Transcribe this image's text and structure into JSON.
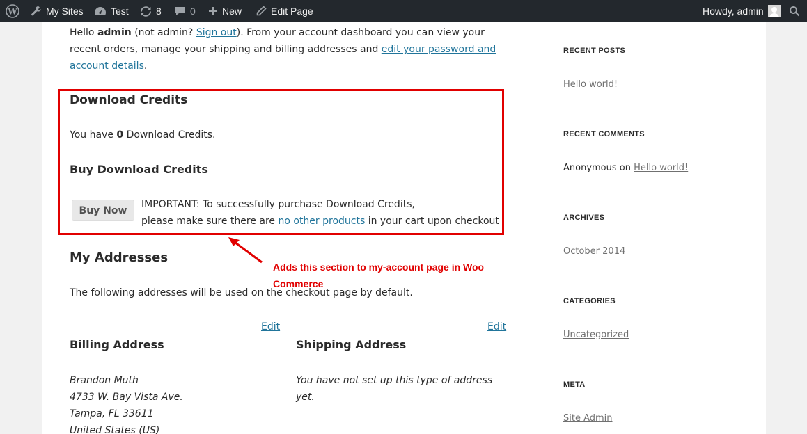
{
  "adminbar": {
    "my_sites": "My Sites",
    "site_name": "Test",
    "updates_count": "8",
    "comments_count": "0",
    "new_label": "New",
    "edit_page": "Edit Page",
    "howdy": "Howdy, admin"
  },
  "intro": {
    "hello": "Hello ",
    "user": "admin",
    "not_user": " (not admin? ",
    "sign_out": "Sign out",
    "after_sign_out": "). From your account dashboard you can view your recent orders, manage your shipping and billing addresses and ",
    "edit_link": "edit your password and account details",
    "end": "."
  },
  "download_credits": {
    "title": "Download Credits",
    "you_have": "You have ",
    "count": "0",
    "suffix": " Download Credits.",
    "buy_title": "Buy Download Credits",
    "buy_button": "Buy Now",
    "important_line1": "IMPORTANT: To successfully purchase Download Credits,",
    "important_line2_pre": "please make sure there are ",
    "important_link": "no other products",
    "important_line2_post": " in your cart upon checkout"
  },
  "annotation": "Adds this section to my-account page in Woo Commerce",
  "addresses": {
    "title": "My Addresses",
    "description": "The following addresses will be used on the checkout page by default.",
    "edit_billing": "Edit",
    "edit_shipping": "Edit",
    "billing_title": "Billing Address",
    "shipping_title": "Shipping Address",
    "billing_lines": [
      "Brandon Muth",
      "4733 W. Bay Vista Ave.",
      "Tampa, FL 33611",
      "United States (US)"
    ],
    "shipping_note": "You have not set up this type of address yet."
  },
  "sidebar": {
    "recent_posts_title": "RECENT POSTS",
    "recent_post": "Hello world!",
    "recent_comments_title": "RECENT COMMENTS",
    "comment_author": "Anonymous",
    "comment_on": " on ",
    "comment_link": "Hello world!",
    "archives_title": "ARCHIVES",
    "archive_item": "October 2014",
    "categories_title": "CATEGORIES",
    "category_item": "Uncategorized",
    "meta_title": "META",
    "meta_item": "Site Admin"
  },
  "colors": {
    "adminbar_bg": "#23282d",
    "highlight_red": "#e10000",
    "link_blue": "#21759b"
  }
}
